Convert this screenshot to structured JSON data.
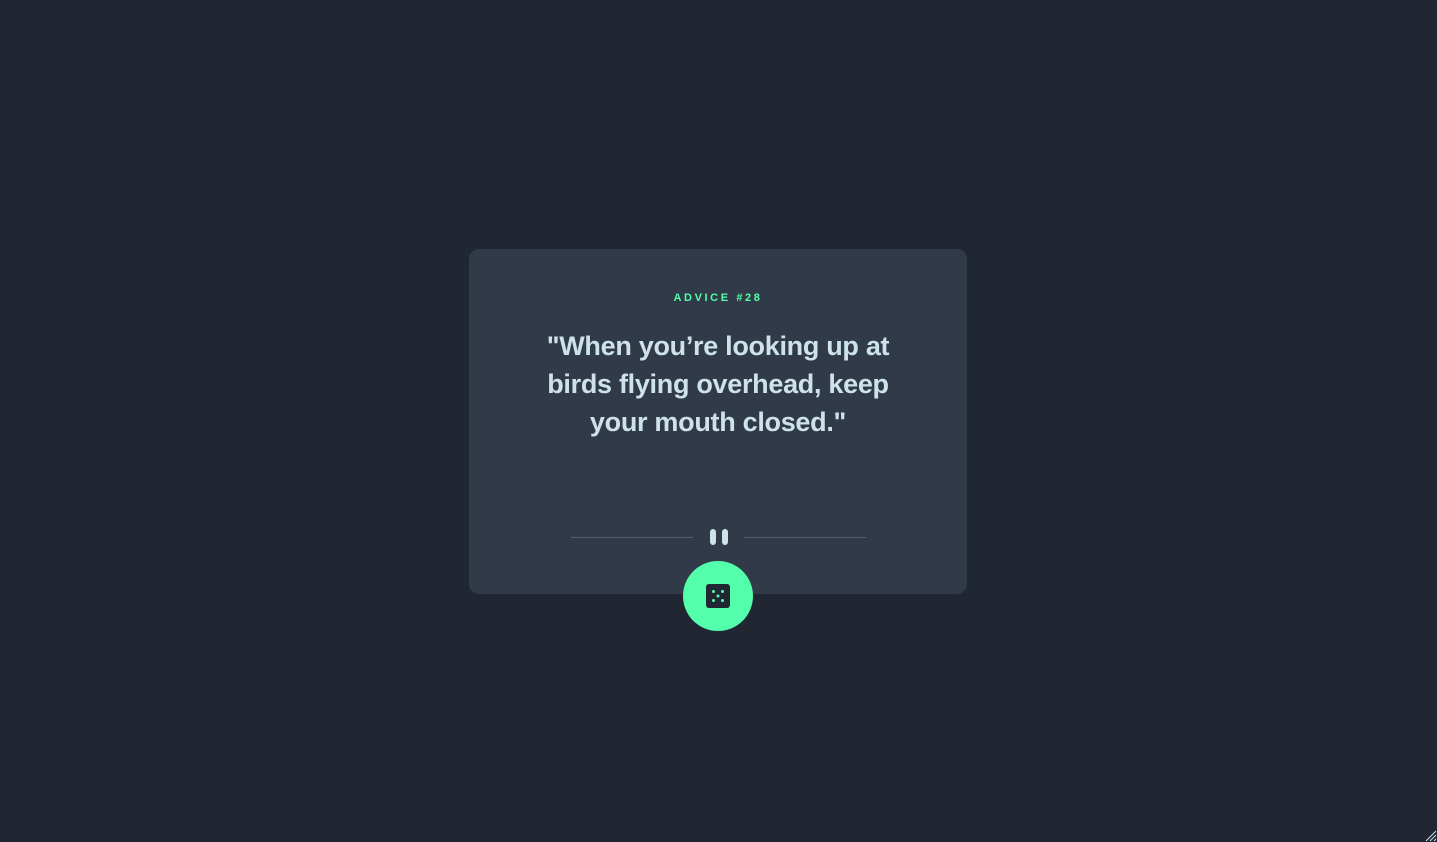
{
  "advice": {
    "label": "ADVICE #28",
    "quote": "\"When you’re looking up at birds flying overhead, keep your mouth closed.\""
  },
  "controls": {
    "dice_button_icon": "dice-icon",
    "divider_icon": "pause-icon"
  },
  "colors": {
    "background": "#202733",
    "card": "#313a48",
    "accent": "#53ffaa",
    "text": "#cee3e9",
    "divider": "#4f5d74"
  }
}
